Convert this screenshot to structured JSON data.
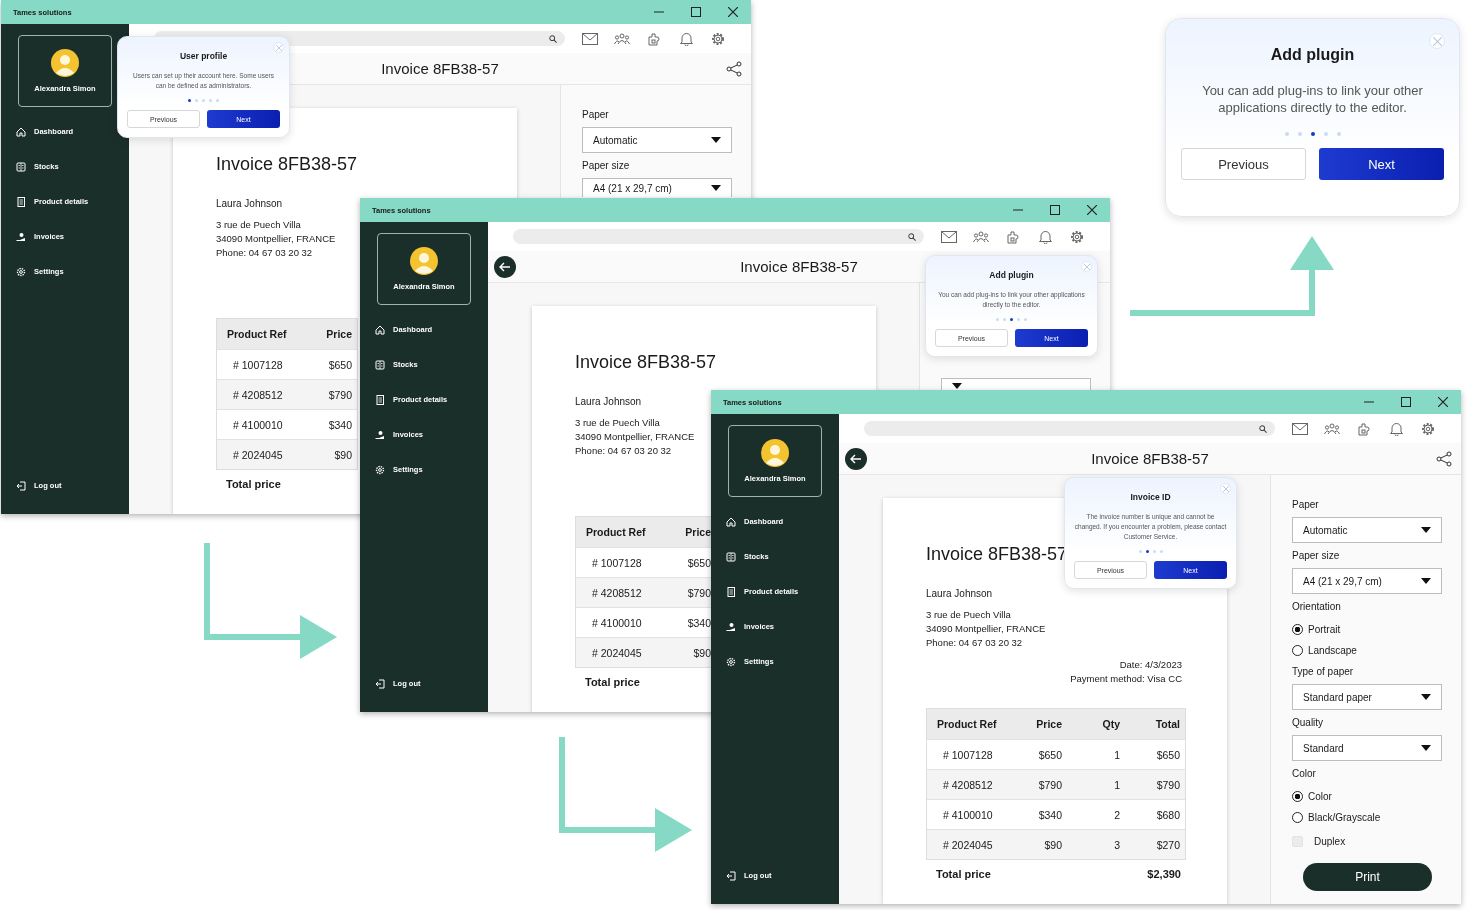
{
  "windows": [
    {
      "app_title": "Tames solutions",
      "profile_name": "Alexandra Simon",
      "nav": [
        {
          "label": "Dashboard"
        },
        {
          "label": "Stocks"
        },
        {
          "label": "Product details"
        },
        {
          "label": "Invoices"
        },
        {
          "label": "Settings"
        }
      ],
      "logout": "Log out",
      "title": "Invoice 8FB38-57",
      "tour": {
        "title": "User profile",
        "text": "Users can set up their account here. Some users can be defined as administrators.",
        "dots": [
          {
            "selected": true
          },
          {
            "selected": false
          },
          {
            "selected": false
          },
          {
            "selected": false
          },
          {
            "selected": false
          }
        ],
        "previous": "Previous",
        "next": "Next"
      },
      "document": {
        "title": "Invoice 8FB38-57",
        "customer": "Laura Johnson",
        "address": [
          "3 rue de Puech Villa",
          "34090 Montpellier, FRANCE",
          "Phone: 04 67 03 20 32"
        ],
        "table": {
          "columns": [
            "Product Ref",
            "Price"
          ],
          "rows": [
            [
              "# 1007128",
              "$650"
            ],
            [
              "# 4208512",
              "$790"
            ],
            [
              "# 4100010",
              "$340"
            ],
            [
              "# 2024045",
              "$90"
            ]
          ],
          "total": [
            "Total price"
          ]
        }
      },
      "panel": [
        {
          "kind": "label",
          "text": "Paper"
        },
        {
          "kind": "select",
          "value": "Automatic"
        },
        {
          "kind": "label",
          "text": "Paper size"
        },
        {
          "kind": "select",
          "value": "A4 (21 x 29,7 cm)"
        }
      ]
    },
    {
      "app_title": "Tames solutions",
      "profile_name": "Alexandra Simon",
      "nav": [
        {
          "label": "Dashboard"
        },
        {
          "label": "Stocks"
        },
        {
          "label": "Product details"
        },
        {
          "label": "Invoices"
        },
        {
          "label": "Settings"
        }
      ],
      "logout": "Log out",
      "title": "Invoice 8FB38-57",
      "tour": {
        "title": "Add plugin",
        "text": "You can add plug-ins to link your other applications directly to the editor.",
        "dots": [
          {
            "selected": false
          },
          {
            "selected": false
          },
          {
            "selected": true
          },
          {
            "selected": false
          },
          {
            "selected": false
          }
        ],
        "previous": "Previous",
        "next": "Next"
      },
      "document": {
        "title": "Invoice 8FB38-57",
        "customer": "Laura Johnson",
        "address": [
          "3 rue de Puech Villa",
          "34090 Montpellier, FRANCE",
          "Phone: 04 67 03 20 32"
        ],
        "table": {
          "columns": [
            "Product Ref",
            "Price"
          ],
          "rows": [
            [
              "# 1007128",
              "$650"
            ],
            [
              "# 4208512",
              "$790"
            ],
            [
              "# 4100010",
              "$340"
            ],
            [
              "# 2024045",
              "$90"
            ]
          ],
          "total": [
            "Total price"
          ]
        }
      },
      "panel": [
        {
          "kind": "select"
        }
      ]
    },
    {
      "app_title": "Tames solutions",
      "profile_name": "Alexandra Simon",
      "nav": [
        {
          "label": "Dashboard"
        },
        {
          "label": "Stocks"
        },
        {
          "label": "Product details"
        },
        {
          "label": "Invoices"
        },
        {
          "label": "Settings"
        }
      ],
      "logout": "Log out",
      "title": "Invoice 8FB38-57",
      "tour": {
        "title": "Invoice ID",
        "text": "The invoice number is unique and cannot be changed. If you encounter a problem, please contact Customer Service.",
        "dots": [
          {
            "selected": false
          },
          {
            "selected": true
          },
          {
            "selected": false
          },
          {
            "selected": false
          }
        ],
        "previous": "Previous",
        "next": "Next"
      },
      "document": {
        "title": "Invoice 8FB38-57",
        "customer": "Laura Johnson",
        "address": [
          "3 rue de Puech Villa",
          "34090 Montpellier, FRANCE",
          "Phone: 04 67 03 20 32"
        ],
        "meta": [
          "Date: 4/3/2023",
          "Payment method: Visa CC"
        ],
        "table": {
          "columns": [
            "Product Ref",
            "Price",
            "Qty",
            "Total"
          ],
          "rows": [
            [
              "# 1007128",
              "$650",
              "1",
              "$650"
            ],
            [
              "# 4208512",
              "$790",
              "1",
              "$790"
            ],
            [
              "# 4100010",
              "$340",
              "2",
              "$680"
            ],
            [
              "# 2024045",
              "$90",
              "3",
              "$270"
            ]
          ],
          "total": [
            "Total price",
            "$2,390"
          ]
        }
      },
      "panel": [
        {
          "kind": "label",
          "text": "Paper"
        },
        {
          "kind": "select",
          "value": "Automatic"
        },
        {
          "kind": "label",
          "text": "Paper size"
        },
        {
          "kind": "select",
          "value": "A4 (21 x 29,7 cm)"
        },
        {
          "kind": "label",
          "text": "Orientation"
        },
        {
          "kind": "radio",
          "text": "Portrait",
          "selected": true
        },
        {
          "kind": "radio",
          "text": "Landscape",
          "selected": false
        },
        {
          "kind": "label",
          "text": "Type of paper"
        },
        {
          "kind": "select",
          "value": "Standard paper"
        },
        {
          "kind": "label",
          "text": "Quality"
        },
        {
          "kind": "select",
          "value": "Standard"
        },
        {
          "kind": "label",
          "text": "Color"
        },
        {
          "kind": "radio",
          "text": "Color",
          "selected": true
        },
        {
          "kind": "radio",
          "text": "Black/Grayscale",
          "selected": false
        },
        {
          "kind": "checkbox",
          "text": "Duplex",
          "checked": false
        },
        {
          "kind": "button",
          "text": "Print"
        }
      ]
    }
  ],
  "callout": {
    "title": "Add plugin",
    "text": "You can add plug-ins to link your other applications directly to the editor.",
    "dots": [
      {
        "selected": false
      },
      {
        "selected": false
      },
      {
        "selected": true
      },
      {
        "selected": false
      },
      {
        "selected": false
      }
    ],
    "previous": "Previous",
    "next": "Next"
  }
}
